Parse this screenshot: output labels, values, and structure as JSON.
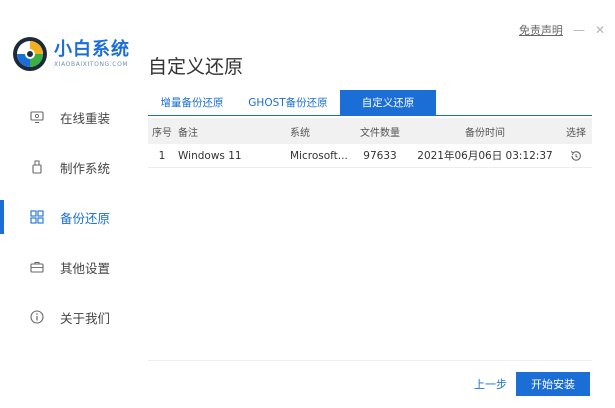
{
  "app": {
    "logo_name": "小白系统",
    "logo_sub": "XIAOBAIXITONG.COM",
    "page_title": "自定义还原",
    "disclaimer": "免责声明",
    "minimize": "—",
    "close": "✕"
  },
  "sidebar": {
    "items": [
      {
        "label": "在线重装",
        "icon": "monitor-icon"
      },
      {
        "label": "制作系统",
        "icon": "usb-drive-icon"
      },
      {
        "label": "备份还原",
        "icon": "backup-grid-icon",
        "active": true
      },
      {
        "label": "其他设置",
        "icon": "briefcase-icon"
      },
      {
        "label": "关于我们",
        "icon": "info-icon"
      }
    ]
  },
  "tabs": [
    {
      "label": "增量备份还原"
    },
    {
      "label": "GHOST备份还原"
    },
    {
      "label": "自定义还原",
      "active": true
    }
  ],
  "table": {
    "headers": {
      "no": "序号",
      "note": "备注",
      "system": "系统",
      "size": "文件数量",
      "time": "备份时间",
      "select": "选择"
    },
    "rows": [
      {
        "no": "1",
        "note": "Windows 11",
        "system": "Microsoft...",
        "size": "97633",
        "time": "2021年06月06日 03:12:37",
        "select_icon": "restore-icon"
      }
    ]
  },
  "footer": {
    "prev_label": "上一步",
    "start_label": "开始安装"
  },
  "colors": {
    "accent": "#1a6ed6",
    "header_bg": "#f1f1f1"
  }
}
